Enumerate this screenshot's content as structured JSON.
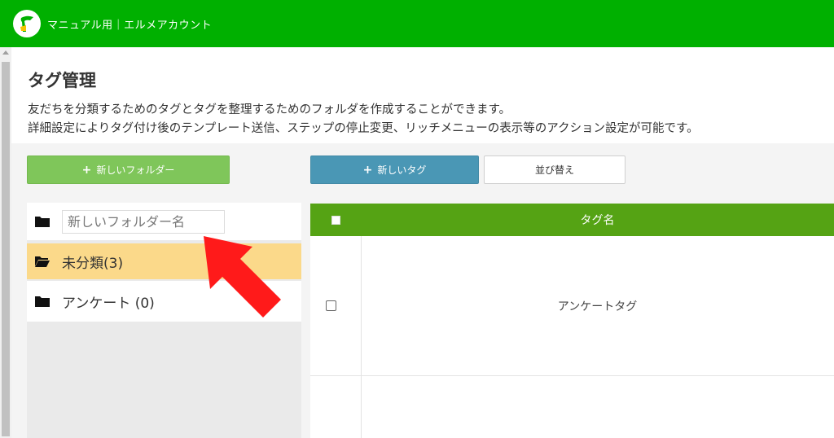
{
  "header": {
    "app_title": "マニュアル用｜エルメアカウント",
    "brand_color": "#00b000"
  },
  "page": {
    "title": "タグ管理",
    "description_line1": "友だちを分類するためのタグとタグを整理するためのフォルダを作成することができます。",
    "description_line2": "詳細設定によりタグ付け後のテンプレート送信、ステップの停止変更、リッチメニューの表示等のアクション設定が可能です。"
  },
  "toolbar": {
    "new_folder_label": "新しいフォルダー",
    "new_tag_label": "新しいタグ",
    "sort_label": "並び替え",
    "plus_icon": "+"
  },
  "folders": {
    "input_placeholder": "新しいフォルダー名",
    "items": [
      {
        "label": "未分類(3)",
        "active": true
      },
      {
        "label": "アンケート (0)",
        "active": false
      }
    ]
  },
  "tag_table": {
    "header_name": "タグ名",
    "header_color": "#55a314",
    "rows": [
      {
        "name": "アンケートタグ"
      }
    ]
  },
  "annotation": {
    "arrow_color": "#ff1a1a",
    "icon": "red-arrow-pointing-up-left"
  }
}
